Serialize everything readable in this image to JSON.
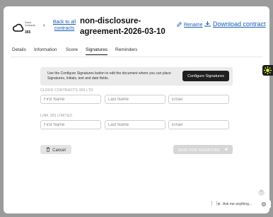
{
  "logo": {
    "text": "Cloud Contracts",
    "number": "365"
  },
  "header": {
    "back_link": "Back to all contracts",
    "title": "non-disclosure-agreement-2026-03-10",
    "rename": "Rename",
    "download": "Download contract"
  },
  "tabs": [
    "Details",
    "Information",
    "Score",
    "Signatures",
    "Reminders"
  ],
  "active_tab": "Signatures",
  "info": {
    "text": "Use the Configure Signatures button to edit the document where you can place Signatures, Initials, text and date fields.",
    "button": "Configure Signatures"
  },
  "parties": [
    {
      "label": "CLOUD CONTRACTS 365 LTD",
      "first_name_placeholder": "First Name",
      "last_name_placeholder": "Last Name",
      "email_placeholder": "Email"
    },
    {
      "label": "LINK 365 LIMITED",
      "first_name_placeholder": "First Name",
      "last_name_placeholder": "Last Name",
      "email_placeholder": "Email"
    }
  ],
  "actions": {
    "cancel": "Cancel",
    "send": "SEND FOR SIGNATURE"
  },
  "assistant": {
    "placeholder": "Ask me anything..."
  },
  "colors": {
    "link": "#1a5fb4",
    "dark_button": "#1f1f1f",
    "side_badge_icon": "#e8ff3a"
  }
}
